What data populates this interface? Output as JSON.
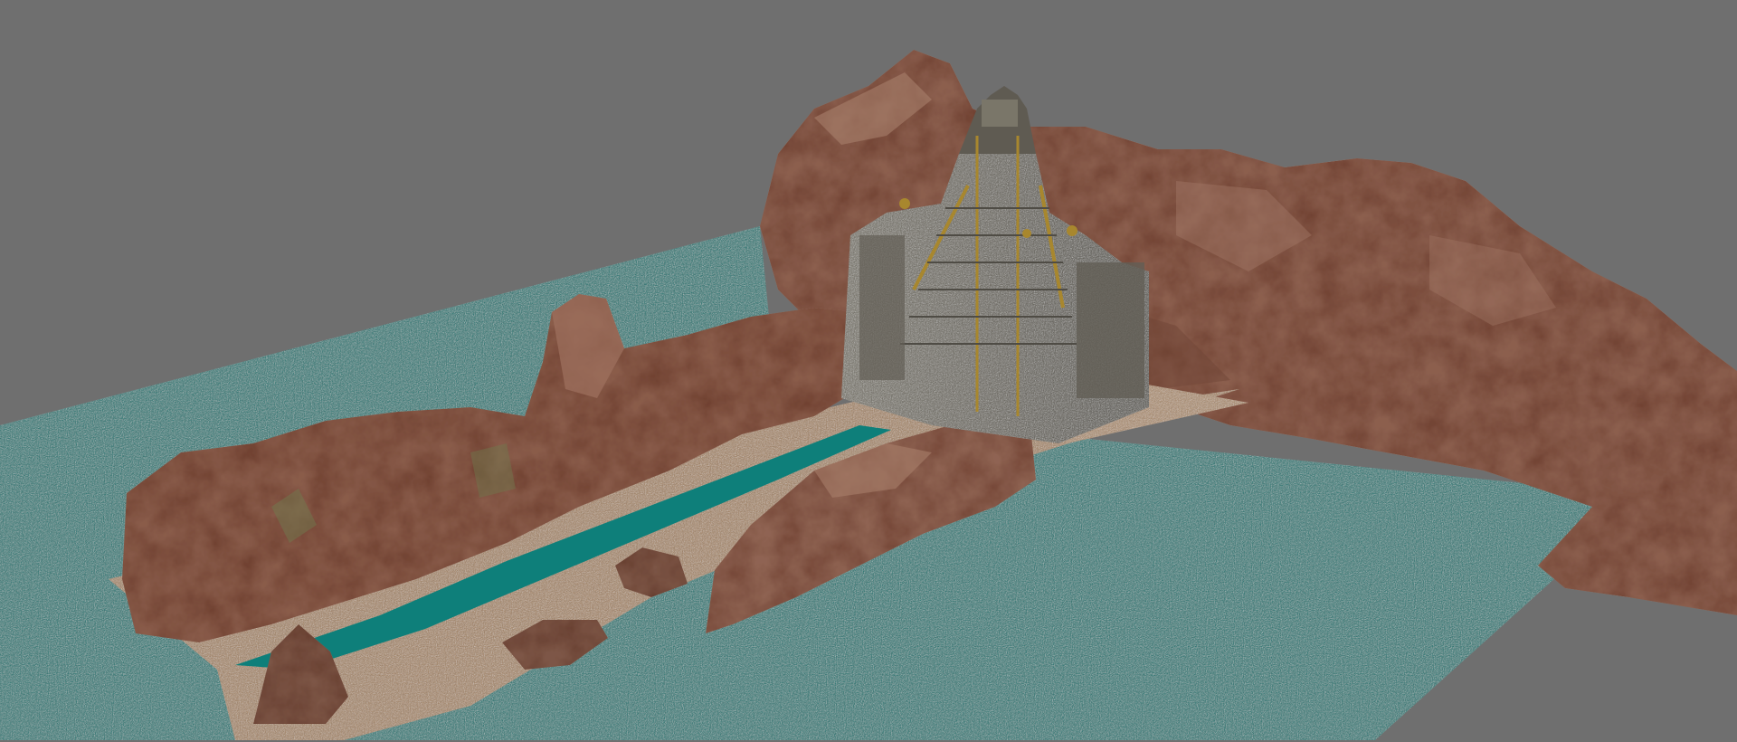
{
  "scene": {
    "objects": [
      {
        "name": "water-plane",
        "color": "#0d7a76"
      },
      {
        "name": "back-cliff",
        "color": "#8c5f4e"
      },
      {
        "name": "temple-pyramid",
        "color": "#6a665c",
        "trim": "#a8872e"
      },
      {
        "name": "left-rock-ridge",
        "color": "#8a5c4a"
      },
      {
        "name": "right-rock-ridge",
        "color": "#8f6352"
      },
      {
        "name": "sand-floor",
        "color": "#a98867"
      },
      {
        "name": "river-channel",
        "color": "#0e7f7a"
      },
      {
        "name": "boulders",
        "color": "#7d5646"
      }
    ]
  },
  "colors": {
    "background": "#6f6f6f",
    "water": "#0d7a76",
    "rock": "#8a5c4a",
    "rock_light": "#b58a77",
    "rock_dark": "#5e3a2d",
    "sand": "#a98867",
    "stone": "#6a665c",
    "gold": "#a8872e"
  }
}
